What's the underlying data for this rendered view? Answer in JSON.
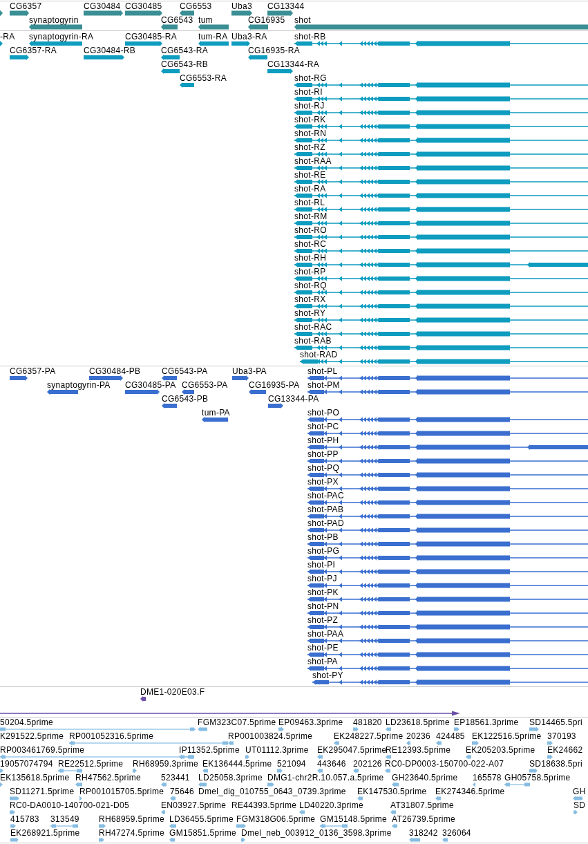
{
  "tracks": [
    {
      "kind": "gene",
      "features": [
        {
          "reverse": false
        },
        {
          "label": "CG6357",
          "reverse": false
        },
        {
          "label": "CG30484",
          "reverse": false
        },
        {
          "label": "CG30485",
          "reverse": false
        },
        {
          "label": "CG6553",
          "reverse": true
        },
        {
          "label": "Uba3",
          "reverse": false
        },
        {
          "label": "CG13344",
          "reverse": false
        },
        {
          "label": "synaptogyrin",
          "reverse": true
        },
        {
          "label": "CG6543",
          "reverse": true
        },
        {
          "label": "tum",
          "reverse": true
        },
        {
          "label": "CG16935",
          "reverse": true
        },
        {
          "label": "shot",
          "reverse": true
        }
      ]
    },
    {
      "kind": "transcript",
      "features": [
        {
          "label": "-RA",
          "reverse": false
        },
        {
          "label": "synaptogyrin-RA",
          "reverse": true
        },
        {
          "label": "CG30485-RA",
          "reverse": false
        },
        {
          "label": "tum-RA",
          "reverse": true
        },
        {
          "label": "Uba3-RA",
          "reverse": false
        },
        {
          "label": "shot-RB",
          "reverse": true
        },
        {
          "label": "CG6357-RA",
          "reverse": false
        },
        {
          "label": "CG30484-RB",
          "reverse": false
        },
        {
          "label": "CG6543-RA",
          "reverse": true
        },
        {
          "label": "CG16935-RA",
          "reverse": true
        },
        {
          "label": "CG6543-RB",
          "reverse": true
        },
        {
          "label": "CG13344-RA",
          "reverse": false
        },
        {
          "label": "CG6553-RA",
          "reverse": true
        },
        {
          "label": "shot-RG",
          "reverse": true
        },
        {
          "label": "shot-RI",
          "reverse": true
        },
        {
          "label": "shot-RJ",
          "reverse": true
        },
        {
          "label": "shot-RK",
          "reverse": true
        },
        {
          "label": "shot-RN",
          "reverse": true
        },
        {
          "label": "shot-RZ",
          "reverse": true
        },
        {
          "label": "shot-RAA",
          "reverse": true
        },
        {
          "label": "shot-RE",
          "reverse": true
        },
        {
          "label": "shot-RA",
          "reverse": true
        },
        {
          "label": "shot-RL",
          "reverse": true
        },
        {
          "label": "shot-RM",
          "reverse": true
        },
        {
          "label": "shot-RO",
          "reverse": true
        },
        {
          "label": "shot-RC",
          "reverse": true
        },
        {
          "label": "shot-RH",
          "reverse": true
        },
        {
          "label": "shot-RP",
          "reverse": true
        },
        {
          "label": "shot-RQ",
          "reverse": true
        },
        {
          "label": "shot-RX",
          "reverse": true
        },
        {
          "label": "shot-RY",
          "reverse": true
        },
        {
          "label": "shot-RAC",
          "reverse": true
        },
        {
          "label": "shot-RAB",
          "reverse": true
        },
        {
          "label": "shot-RAD",
          "reverse": true
        }
      ]
    },
    {
      "kind": "protein",
      "features": [
        {
          "label": "CG6357-PA",
          "reverse": false
        },
        {
          "label": "CG30484-PB",
          "reverse": false
        },
        {
          "label": "CG6543-PA",
          "reverse": true
        },
        {
          "label": "Uba3-PA",
          "reverse": false
        },
        {
          "label": "shot-PL",
          "reverse": true
        },
        {
          "label": "synaptogyrin-PA",
          "reverse": true
        },
        {
          "label": "CG30485-PA",
          "reverse": false
        },
        {
          "label": "CG6553-PA",
          "reverse": true
        },
        {
          "label": "CG16935-PA",
          "reverse": true
        },
        {
          "label": "shot-PM",
          "reverse": true
        },
        {
          "label": "CG6543-PB",
          "reverse": true
        },
        {
          "label": "CG13344-PA",
          "reverse": false
        },
        {
          "label": "tum-PA",
          "reverse": true
        },
        {
          "label": "shot-PO",
          "reverse": true
        },
        {
          "label": "shot-PC",
          "reverse": true
        },
        {
          "label": "shot-PH",
          "reverse": true
        },
        {
          "label": "shot-PP",
          "reverse": true
        },
        {
          "label": "shot-PQ",
          "reverse": true
        },
        {
          "label": "shot-PX",
          "reverse": true
        },
        {
          "label": "shot-PAC",
          "reverse": true
        },
        {
          "label": "shot-PAB",
          "reverse": true
        },
        {
          "label": "shot-PAD",
          "reverse": true
        },
        {
          "label": "shot-PB",
          "reverse": true
        },
        {
          "label": "shot-PG",
          "reverse": true
        },
        {
          "label": "shot-PI",
          "reverse": true
        },
        {
          "label": "shot-PJ",
          "reverse": true
        },
        {
          "label": "shot-PK",
          "reverse": true
        },
        {
          "label": "shot-PN",
          "reverse": true
        },
        {
          "label": "shot-PZ",
          "reverse": true
        },
        {
          "label": "shot-PAA",
          "reverse": true
        },
        {
          "label": "shot-PE",
          "reverse": true
        },
        {
          "label": "shot-PA",
          "reverse": true
        },
        {
          "label": "shot-PY",
          "reverse": true
        }
      ]
    },
    {
      "kind": "clone",
      "features": [
        {
          "label": "DME1-020E03.F",
          "reverse": true
        },
        {
          "reverse": false
        }
      ]
    },
    {
      "kind": "est",
      "features": [
        {
          "label": "50204.5prime",
          "reverse": false
        },
        {
          "label": "FGM323C07.5prime",
          "reverse": true
        },
        {
          "label": "EP09463.3prime",
          "reverse": false
        },
        {
          "label": "481820",
          "reverse": false
        },
        {
          "label": "LD23618.5prime",
          "reverse": true
        },
        {
          "label": "EP18561.3prime",
          "reverse": false
        },
        {
          "label": "SD14465.5pri",
          "reverse": false
        },
        {
          "label": "K291522.5prime"
        },
        {
          "label": "RP001052316.5prime",
          "reverse": true
        },
        {
          "label": "RP001003824.5prime",
          "reverse": true
        },
        {
          "label": "EK248227.5prime",
          "reverse": true
        },
        {
          "label": "20236",
          "reverse": true
        },
        {
          "label": "424485",
          "reverse": true
        },
        {
          "label": "EK122516.5prime",
          "reverse": false
        },
        {
          "label": "370193",
          "reverse": false
        },
        {
          "label": "RP003461769.5prime",
          "reverse": true
        },
        {
          "label": "IP11352.5prime",
          "reverse": true
        },
        {
          "label": "UT01112.3prime",
          "reverse": false
        },
        {
          "label": "EK295047.5prime",
          "reverse": true
        },
        {
          "label": "RE12393.5prime",
          "reverse": true
        },
        {
          "label": "EK205203.5prime",
          "reverse": true
        },
        {
          "label": "EK24662",
          "reverse": false
        },
        {
          "label": "19057074794",
          "reverse": false
        },
        {
          "label": "RE22512.5prime",
          "reverse": true
        },
        {
          "label": "RH68959.3prime",
          "reverse": false
        },
        {
          "label": "EK136444.5prime",
          "reverse": true
        },
        {
          "label": "521094",
          "reverse": false
        },
        {
          "label": "443646",
          "reverse": true
        },
        {
          "label": "202126",
          "reverse": true
        },
        {
          "label": "RC0-DP0003-150700-022-A07",
          "reverse": true
        },
        {
          "label": "SD18638.5pri",
          "reverse": false
        },
        {
          "label": "EK135618.5prime",
          "reverse": false
        },
        {
          "label": "RH47562.5prime",
          "reverse": true
        },
        {
          "label": "523441",
          "reverse": true
        },
        {
          "label": "LD25058.3prime",
          "reverse": true
        },
        {
          "label": "DMG1-chr2R.10.057.a.5prime",
          "reverse": false
        },
        {
          "label": "GH23640.5prime",
          "reverse": true
        },
        {
          "label": "165578",
          "reverse": true
        },
        {
          "label": "GH05758.5prime",
          "reverse": true
        },
        {
          "label": "SD11271.5prime",
          "reverse": false
        },
        {
          "label": "RP001015705.5prime",
          "reverse": false
        },
        {
          "label": "75646",
          "reverse": true
        },
        {
          "label": "Dmel_dig_010755_0643_0739.3prime"
        },
        {
          "label": "EK147530.5prime",
          "reverse": true
        },
        {
          "label": "EK274346.5prime",
          "reverse": true
        },
        {
          "label": "GH",
          "reverse": true
        },
        {
          "label": "RC0-DA0010-140700-021-D05",
          "reverse": false
        },
        {
          "label": "EN03927.5prime",
          "reverse": true
        },
        {
          "label": "RE44393.5prime"
        },
        {
          "label": "LD40220.3prime",
          "reverse": true
        },
        {
          "label": "AT31807.5prime",
          "reverse": true
        },
        {
          "label": "SD",
          "reverse": false
        },
        {
          "label": "415783",
          "reverse": false
        },
        {
          "label": "313549",
          "reverse": true
        },
        {
          "label": "RH68959.5prime",
          "reverse": false
        },
        {
          "label": "LD36455.5prime",
          "reverse": true
        },
        {
          "label": "FGM318G06.5prime",
          "reverse": false
        },
        {
          "label": "GM15148.5prime",
          "reverse": true
        },
        {
          "label": "AT26739.5prime",
          "reverse": true
        },
        {
          "label": "EK268921.5prime",
          "reverse": false
        },
        {
          "label": "RH47274.5prime",
          "reverse": false
        },
        {
          "label": "GM15851.5prime",
          "reverse": true
        },
        {
          "label": "Dmel_neb_003912_0136_3598.3prime",
          "reverse": false
        },
        {
          "label": "318242",
          "reverse": true
        },
        {
          "label": "326064",
          "reverse": true
        }
      ]
    }
  ]
}
